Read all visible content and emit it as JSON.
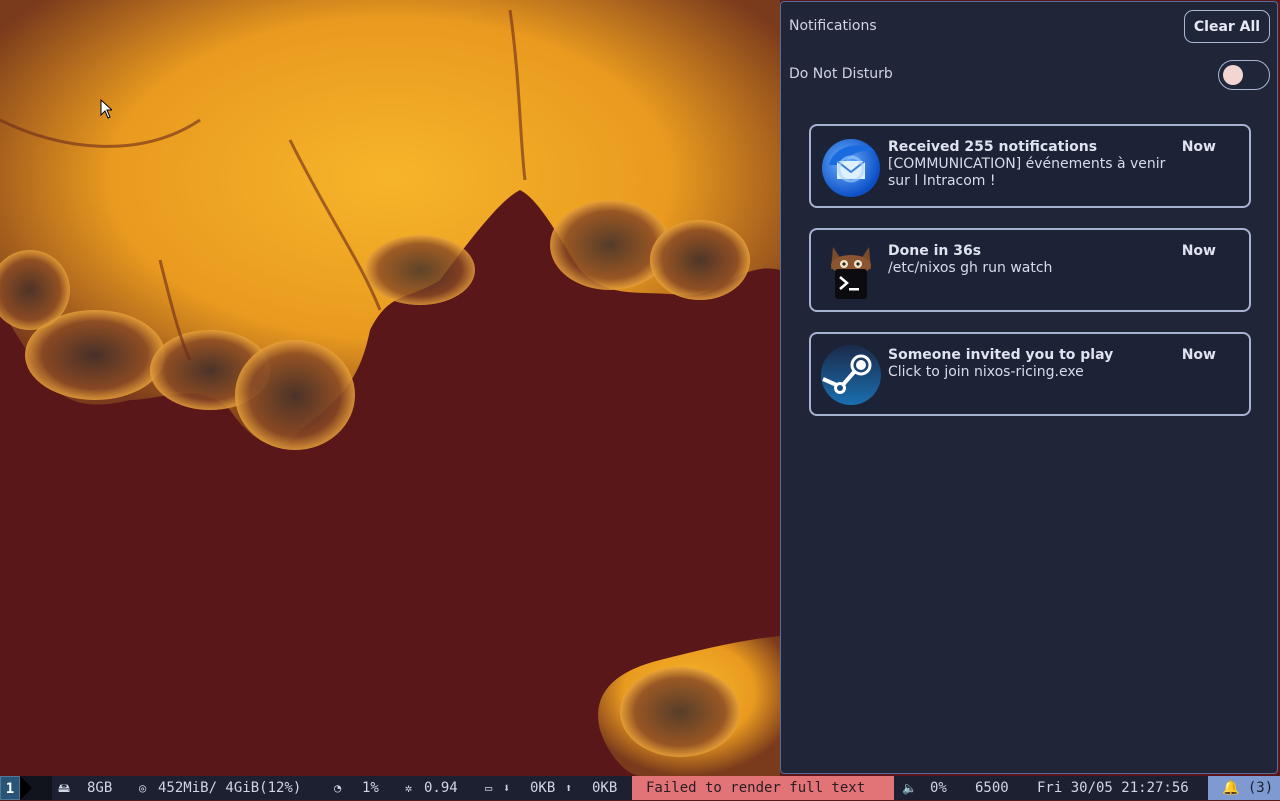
{
  "notification_center": {
    "title": "Notifications",
    "clear_all_label": "Clear All",
    "dnd_label": "Do Not Disturb",
    "dnd_enabled": false
  },
  "notifications": [
    {
      "app_icon": "thunderbird-icon",
      "title": "Received 255 notifications",
      "body": "[COMMUNICATION] événements à venir sur l Intracom !",
      "time": "Now"
    },
    {
      "app_icon": "terminal-cat-icon",
      "title": "Done in 36s",
      "body": "/etc/nixos gh run watch",
      "time": "Now"
    },
    {
      "app_icon": "steam-icon",
      "title": "Someone invited you to play",
      "body": "Click to join nixos-ricing.exe",
      "time": "Now"
    }
  ],
  "statusbar": {
    "workspace": "1",
    "disk": "8GB",
    "memory": "452MiB/ 4GiB(12%)",
    "cpu": "1%",
    "load": "0.94",
    "net_down": "0KB",
    "net_up": "0KB",
    "error": "Failed to render full text",
    "volume": "0%",
    "color_temp": "6500",
    "datetime": "Fri 30/05 21:27:56",
    "notification_count": "(3)",
    "colors": {
      "error_bg": "#e27477",
      "notif_bg": "#7f9ad0",
      "workspace_bg": "#285577"
    }
  }
}
